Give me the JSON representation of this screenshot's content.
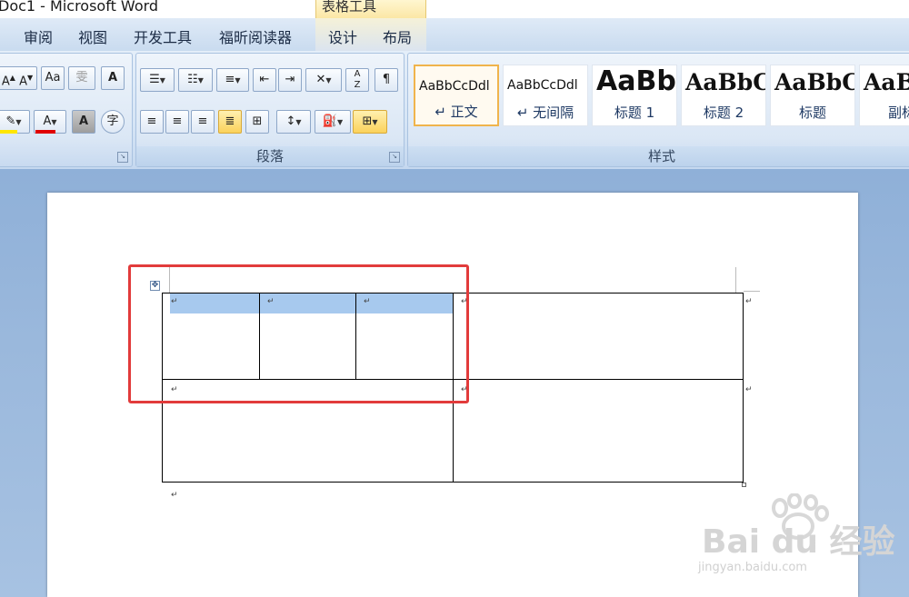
{
  "window": {
    "title": "Doc1 - Microsoft Word",
    "context_tab_header": "表格工具"
  },
  "tabs": [
    {
      "label": "审阅"
    },
    {
      "label": "视图"
    },
    {
      "label": "开发工具"
    },
    {
      "label": "福昕阅读器"
    },
    {
      "label": "设计"
    },
    {
      "label": "布局"
    }
  ],
  "ribbon": {
    "font_group_label": "",
    "paragraph_group_label": "段落",
    "styles_group_label": "样式",
    "styles": [
      {
        "sample": "AaBbCcDdl",
        "name": "↵ 正文",
        "selected": true
      },
      {
        "sample": "AaBbCcDdl",
        "name": "↵ 无间隔",
        "selected": false
      },
      {
        "sample": "AaBb",
        "name": "标题 1",
        "selected": false
      },
      {
        "sample": "AaBbC",
        "name": "标题 2",
        "selected": false
      },
      {
        "sample": "AaBbC",
        "name": "标题",
        "selected": false
      },
      {
        "sample": "AaB",
        "name": "副标",
        "selected": false
      }
    ]
  },
  "document": {
    "paragraph_mark": "↵",
    "highlight_color": "#a7c9ee",
    "annotation_color": "#e23b3b"
  },
  "watermark": {
    "text": "Bai du 经验",
    "url": "jingyan.baidu.com"
  }
}
